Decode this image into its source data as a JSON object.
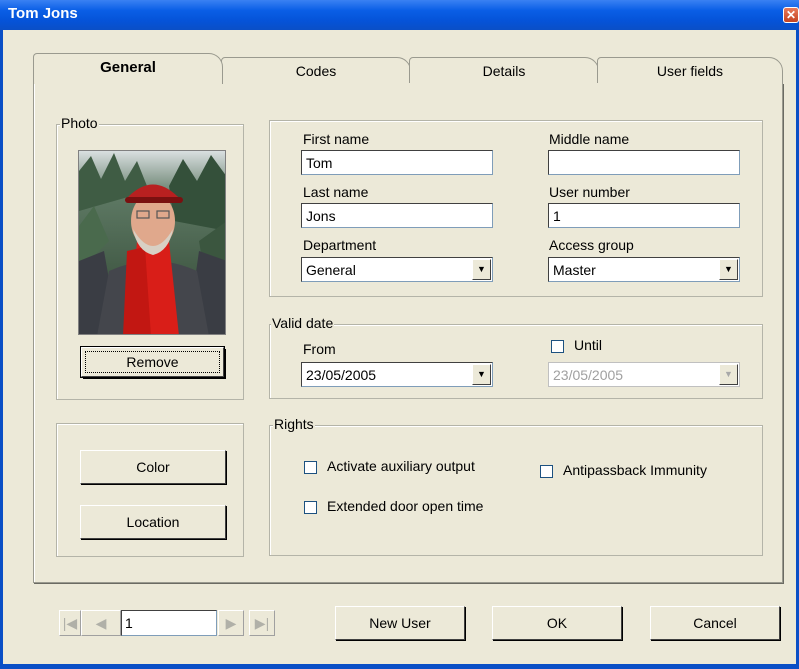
{
  "window": {
    "title": "Tom Jons",
    "close_glyph": "✕"
  },
  "tabs": [
    {
      "label": "General",
      "active": true
    },
    {
      "label": "Codes",
      "active": false
    },
    {
      "label": "Details",
      "active": false
    },
    {
      "label": "User fields",
      "active": false
    }
  ],
  "photo": {
    "group_label": "Photo",
    "remove_label": "Remove"
  },
  "side_buttons": {
    "color_label": "Color",
    "location_label": "Location"
  },
  "identity": {
    "first_name_label": "First name",
    "first_name_value": "Tom",
    "middle_name_label": "Middle name",
    "middle_name_value": "",
    "last_name_label": "Last name",
    "last_name_value": "Jons",
    "user_number_label": "User number",
    "user_number_value": "1",
    "department_label": "Department",
    "department_value": "General",
    "access_group_label": "Access group",
    "access_group_value": "Master"
  },
  "valid_date": {
    "group_label": "Valid date",
    "from_label": "From",
    "from_value": "23/05/2005",
    "until_label": "Until",
    "until_value": "23/05/2005",
    "until_checked": false
  },
  "rights": {
    "group_label": "Rights",
    "aux_output_label": "Activate auxiliary output",
    "extended_door_label": "Extended door open time",
    "antipassback_label": "Antipassback Immunity"
  },
  "navigator": {
    "record_value": "1"
  },
  "footer": {
    "new_user_label": "New User",
    "ok_label": "OK",
    "cancel_label": "Cancel"
  },
  "icons": {
    "first": "first-record-icon",
    "prev": "previous-record-icon",
    "next": "next-record-icon",
    "last": "last-record-icon",
    "dropdown": "chevron-down-icon"
  }
}
